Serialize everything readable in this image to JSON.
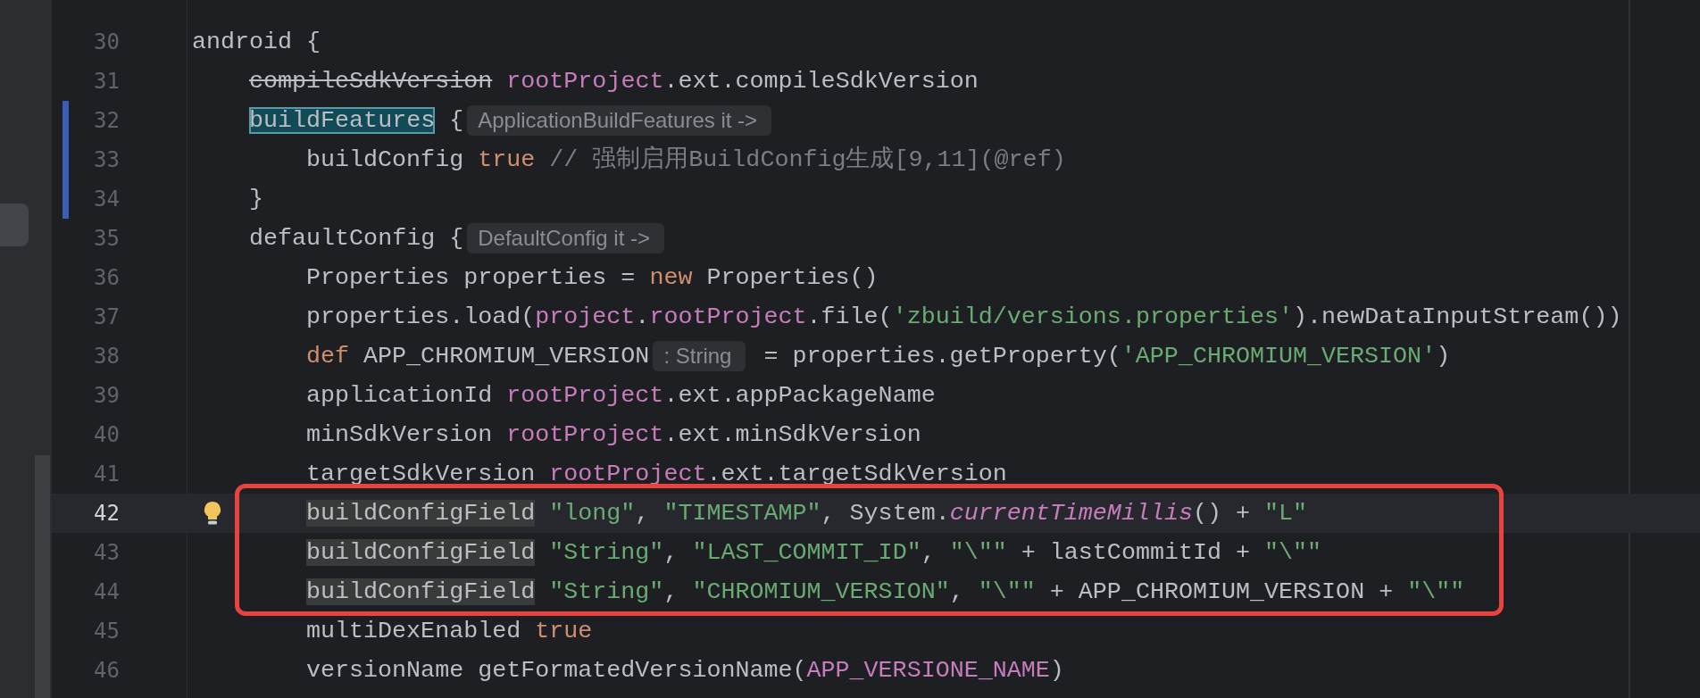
{
  "lines": [
    {
      "number": "30",
      "modified": false,
      "current": false,
      "boxed": false,
      "bulb": false,
      "tokens": [
        {
          "kind": "text",
          "text": "android {"
        }
      ],
      "children": [
        {
          "number": "31",
          "modified": false,
          "current": false,
          "boxed": false,
          "bulb": false,
          "tokens": [
            {
              "kind": "deprecated",
              "text": "compileSdkVersion"
            },
            {
              "kind": "field",
              "text": " rootProject"
            },
            {
              "kind": "text",
              "text": ".ext.compileSdkVersion"
            }
          ]
        },
        {
          "number": "32",
          "modified": true,
          "current": false,
          "boxed": false,
          "bulb": false,
          "tokens": [
            {
              "kind": "selected",
              "text": "buildFeatures"
            },
            {
              "kind": "text",
              "text": " {"
            },
            {
              "kind": "hint",
              "text": "ApplicationBuildFeatures it ->"
            }
          ],
          "children": [
            {
              "number": "33",
              "modified": true,
              "current": false,
              "boxed": false,
              "bulb": false,
              "tokens": [
                {
                  "kind": "text",
                  "text": "buildConfig "
                },
                {
                  "kind": "keyword",
                  "text": "true"
                },
                {
                  "kind": "comment",
                  "text": " // 强制启用BuildConfig生成[9,11](@ref)"
                }
              ]
            }
          ]
        },
        {
          "number": "34",
          "modified": true,
          "current": false,
          "boxed": false,
          "bulb": false,
          "tokens": [
            {
              "kind": "text",
              "text": "}"
            }
          ]
        },
        {
          "number": "35",
          "modified": false,
          "current": false,
          "boxed": false,
          "bulb": false,
          "tokens": [
            {
              "kind": "text",
              "text": "defaultConfig {"
            },
            {
              "kind": "hint",
              "text": "DefaultConfig it ->"
            }
          ],
          "children": [
            {
              "number": "36",
              "modified": false,
              "current": false,
              "boxed": false,
              "bulb": false,
              "tokens": [
                {
                  "kind": "text",
                  "text": "Properties properties = "
                },
                {
                  "kind": "keyword",
                  "text": "new"
                },
                {
                  "kind": "text",
                  "text": " Properties()"
                }
              ]
            },
            {
              "number": "37",
              "modified": false,
              "current": false,
              "boxed": false,
              "bulb": false,
              "tokens": [
                {
                  "kind": "text",
                  "text": "properties.load("
                },
                {
                  "kind": "field",
                  "text": "project"
                },
                {
                  "kind": "text",
                  "text": "."
                },
                {
                  "kind": "field",
                  "text": "rootProject"
                },
                {
                  "kind": "text",
                  "text": ".file("
                },
                {
                  "kind": "string",
                  "text": "'zbuild/versions.properties'"
                },
                {
                  "kind": "text",
                  "text": ").newDataInputStream())"
                }
              ]
            },
            {
              "number": "38",
              "modified": false,
              "current": false,
              "boxed": false,
              "bulb": false,
              "tokens": [
                {
                  "kind": "keyword",
                  "text": "def"
                },
                {
                  "kind": "text",
                  "text": " APP_CHROMIUM_VERSION"
                },
                {
                  "kind": "hint",
                  "text": ": String"
                },
                {
                  "kind": "text",
                  "text": " = properties.getProperty("
                },
                {
                  "kind": "string",
                  "text": "'APP_CHROMIUM_VERSION'"
                },
                {
                  "kind": "text",
                  "text": ")"
                }
              ]
            },
            {
              "number": "39",
              "modified": false,
              "current": false,
              "boxed": false,
              "bulb": false,
              "tokens": [
                {
                  "kind": "text",
                  "text": "applicationId "
                },
                {
                  "kind": "field",
                  "text": "rootProject"
                },
                {
                  "kind": "text",
                  "text": ".ext.appPackageName"
                }
              ]
            },
            {
              "number": "40",
              "modified": false,
              "current": false,
              "boxed": false,
              "bulb": false,
              "tokens": [
                {
                  "kind": "text",
                  "text": "minSdkVersion "
                },
                {
                  "kind": "field",
                  "text": "rootProject"
                },
                {
                  "kind": "text",
                  "text": ".ext.minSdkVersion"
                }
              ]
            },
            {
              "number": "41",
              "modified": false,
              "current": false,
              "boxed": false,
              "bulb": false,
              "tokens": [
                {
                  "kind": "text",
                  "text": "targetSdkVersion "
                },
                {
                  "kind": "field",
                  "text": "rootProject"
                },
                {
                  "kind": "text",
                  "text": ".ext.targetSdkVersion"
                }
              ]
            },
            {
              "number": "42",
              "modified": false,
              "current": true,
              "boxed": true,
              "bulb": true,
              "tokens": [
                {
                  "kind": "usage",
                  "text": "buildConfigField"
                },
                {
                  "kind": "string",
                  "text": " \"long\""
                },
                {
                  "kind": "text",
                  "text": ", "
                },
                {
                  "kind": "string",
                  "text": "\"TIMESTAMP\""
                },
                {
                  "kind": "text",
                  "text": ", System."
                },
                {
                  "kind": "call",
                  "text": "currentTimeMillis"
                },
                {
                  "kind": "text",
                  "text": "() + "
                },
                {
                  "kind": "string",
                  "text": "\"L\""
                }
              ]
            },
            {
              "number": "43",
              "modified": false,
              "current": false,
              "boxed": true,
              "bulb": false,
              "tokens": [
                {
                  "kind": "usage",
                  "text": "buildConfigField"
                },
                {
                  "kind": "string",
                  "text": " \"String\""
                },
                {
                  "kind": "text",
                  "text": ", "
                },
                {
                  "kind": "string",
                  "text": "\"LAST_COMMIT_ID\""
                },
                {
                  "kind": "text",
                  "text": ", "
                },
                {
                  "kind": "string",
                  "text": "\"\\\"\""
                },
                {
                  "kind": "text",
                  "text": " + lastCommitId + "
                },
                {
                  "kind": "string",
                  "text": "\"\\\"\""
                }
              ]
            },
            {
              "number": "44",
              "modified": false,
              "current": false,
              "boxed": true,
              "bulb": false,
              "tokens": [
                {
                  "kind": "usage",
                  "text": "buildConfigField"
                },
                {
                  "kind": "string",
                  "text": " \"String\""
                },
                {
                  "kind": "text",
                  "text": ", "
                },
                {
                  "kind": "string",
                  "text": "\"CHROMIUM_VERSION\""
                },
                {
                  "kind": "text",
                  "text": ", "
                },
                {
                  "kind": "string",
                  "text": "\"\\\"\""
                },
                {
                  "kind": "text",
                  "text": " + APP_CHROMIUM_VERSION + "
                },
                {
                  "kind": "string",
                  "text": "\"\\\"\""
                }
              ]
            },
            {
              "number": "45",
              "modified": false,
              "current": false,
              "boxed": false,
              "bulb": false,
              "tokens": [
                {
                  "kind": "text",
                  "text": "multiDexEnabled "
                },
                {
                  "kind": "keyword",
                  "text": "true"
                }
              ]
            },
            {
              "number": "46",
              "modified": false,
              "current": false,
              "boxed": false,
              "bulb": false,
              "tokens": [
                {
                  "kind": "text",
                  "text": "versionName getFormatedVersionName("
                },
                {
                  "kind": "field",
                  "text": "APP_VERSIONE_NAME"
                },
                {
                  "kind": "text",
                  "text": ")"
                }
              ]
            }
          ]
        }
      ]
    }
  ]
}
